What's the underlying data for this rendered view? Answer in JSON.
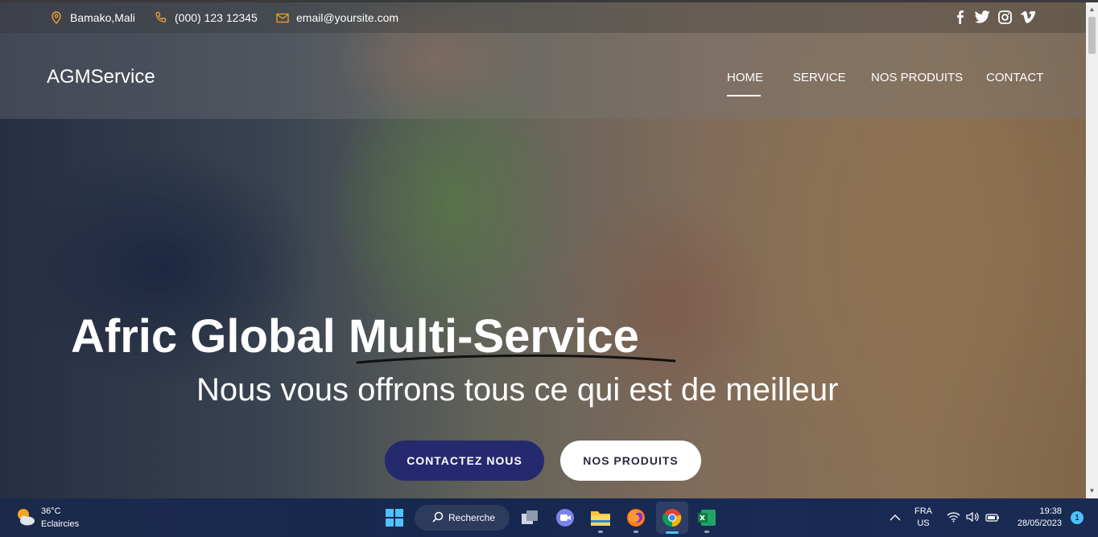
{
  "site": {
    "address": "Bamako,Mali",
    "phone": "(000) 123 12345",
    "email": "email@yoursite.com",
    "brand": "AGMService",
    "nav": [
      "HOME",
      "SERVICE",
      "NOS PRODUITS",
      "CONTACT"
    ],
    "active_nav": "HOME",
    "social_icons": [
      "facebook-icon",
      "twitter-icon",
      "instagram-icon",
      "vimeo-icon"
    ],
    "accent_color": "#f0a030"
  },
  "hero": {
    "title_part1": "Afric Global",
    "title_part2": "Multi-Service",
    "subtitle": "Nous vous offrons tous ce qui est de meilleur",
    "primary_button": "CONTACTEZ NOUS",
    "secondary_button": "NOS PRODUITS",
    "primary_color": "#25296e"
  },
  "taskbar": {
    "weather_temp": "36°C",
    "weather_desc": "Eclaircies",
    "search_label": "Recherche",
    "lang_primary": "FRA",
    "lang_secondary": "US",
    "time": "19:38",
    "date": "28/05/2023",
    "notification_count": "1",
    "apps": [
      "windows-start-icon",
      "task-view-icon",
      "teams-chat-icon",
      "file-explorer-icon",
      "firefox-icon",
      "chrome-icon",
      "excel-icon"
    ]
  }
}
